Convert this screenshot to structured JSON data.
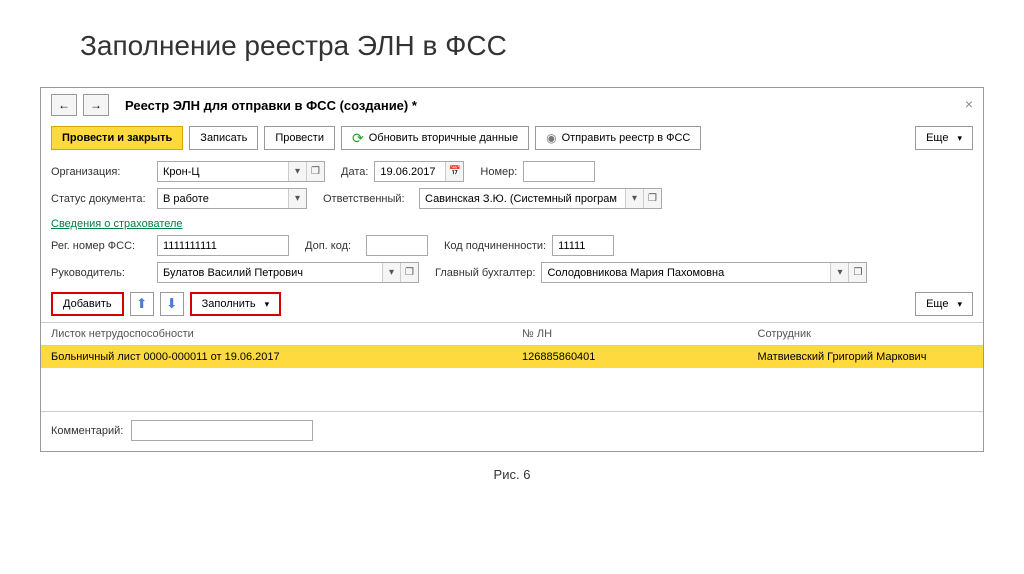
{
  "page_title": "Заполнение реестра ЭЛН в ФСС",
  "window": {
    "title": "Реестр ЭЛН для отправки в ФСС (создание) *"
  },
  "toolbar": {
    "post_close": "Провести и закрыть",
    "write": "Записать",
    "post": "Провести",
    "refresh": "Обновить вторичные данные",
    "send": "Отправить реестр в ФСС",
    "more": "Еще"
  },
  "form": {
    "org_label": "Организация:",
    "org_value": "Крон-Ц",
    "date_label": "Дата:",
    "date_value": "19.06.2017",
    "number_label": "Номер:",
    "number_value": "",
    "status_label": "Статус документа:",
    "status_value": "В работе",
    "responsible_label": "Ответственный:",
    "responsible_value": "Савинская З.Ю. (Системный програм",
    "section_header": "Сведения о страхователе",
    "reg_label": "Рег. номер ФСС:",
    "reg_value": "1111111111",
    "dop_label": "Доп. код:",
    "dop_value": "",
    "sub_label": "Код подчиненности:",
    "sub_value": "11111",
    "head_label": "Руководитель:",
    "head_value": "Булатов Василий Петрович",
    "accountant_label": "Главный бухгалтер:",
    "accountant_value": "Солодовникова Мария Пахомовна",
    "comment_label": "Комментарий:",
    "comment_value": ""
  },
  "subtoolbar": {
    "add": "Добавить",
    "fill": "Заполнить",
    "more": "Еще"
  },
  "table": {
    "col1": "Листок нетрудоспособности",
    "col2": "№ ЛН",
    "col3": "Сотрудник",
    "row1": {
      "sheet": "Больничный лист 0000-000011 от 19.06.2017",
      "number": "126885860401",
      "employee": "Матвиевский Григорий Маркович"
    }
  },
  "caption": "Рис. 6"
}
